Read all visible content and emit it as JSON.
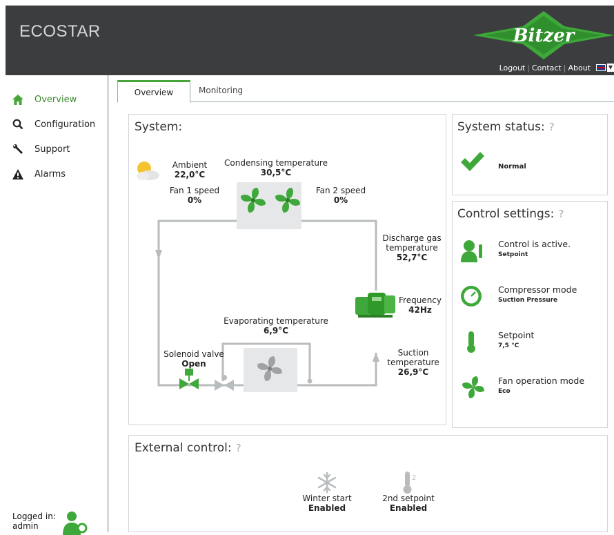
{
  "header": {
    "app_title": "ECOSTAR",
    "logo_text": "Bitzer",
    "links": [
      "Logout",
      "Contact",
      "About"
    ]
  },
  "sidebar": {
    "items": [
      {
        "label": "Overview",
        "icon": "home-icon"
      },
      {
        "label": "Configuration",
        "icon": "search-icon"
      },
      {
        "label": "Support",
        "icon": "wrench-icon"
      },
      {
        "label": "Alarms",
        "icon": "warning-icon"
      }
    ],
    "logged_in_label": "Logged in:",
    "user": "admin"
  },
  "tabs": [
    "Overview",
    "Monitoring"
  ],
  "system": {
    "title": "System:",
    "ambient_label": "Ambient",
    "ambient_value": "22,0°C",
    "condensing_label": "Condensing temperature",
    "condensing_value": "30,5°C",
    "fan1_label": "Fan 1 speed",
    "fan1_value": "0%",
    "fan2_label": "Fan 2 speed",
    "fan2_value": "0%",
    "discharge_label_1": "Discharge gas",
    "discharge_label_2": "temperature",
    "discharge_value": "52,7°C",
    "frequency_label": "Frequency",
    "frequency_value": "42Hz",
    "evaporating_label": "Evaporating temperature",
    "evaporating_value": "6,9°C",
    "solenoid_label": "Solenoid valve",
    "solenoid_value": "Open",
    "suction_label_1": "Suction",
    "suction_label_2": "temperature",
    "suction_value": "26,9°C"
  },
  "system_status": {
    "title": "System status:",
    "help": "?",
    "status": "Normal"
  },
  "control_settings": {
    "title": "Control settings:",
    "help": "?",
    "rows": [
      {
        "label": "Control is active.",
        "value": "Setpoint",
        "icon": "control-active-icon"
      },
      {
        "label": "Compressor mode",
        "value": "Suction Pressure",
        "icon": "gauge-icon"
      },
      {
        "label": "Setpoint",
        "value": "7,5 °C",
        "icon": "thermometer-icon"
      },
      {
        "label": "Fan operation mode",
        "value": "Eco",
        "icon": "fan-icon"
      }
    ]
  },
  "external_control": {
    "title": "External control:",
    "help": "?",
    "winter_label": "Winter start",
    "winter_value": "Enabled",
    "setpoint2_label": "2nd setpoint",
    "setpoint2_value": "Enabled",
    "setpoint2_icon_digit": "2"
  },
  "colors": {
    "header_bg": "#3c3d3f",
    "accent_green": "#46a63a",
    "pipe_gray": "#b9bcbe"
  }
}
